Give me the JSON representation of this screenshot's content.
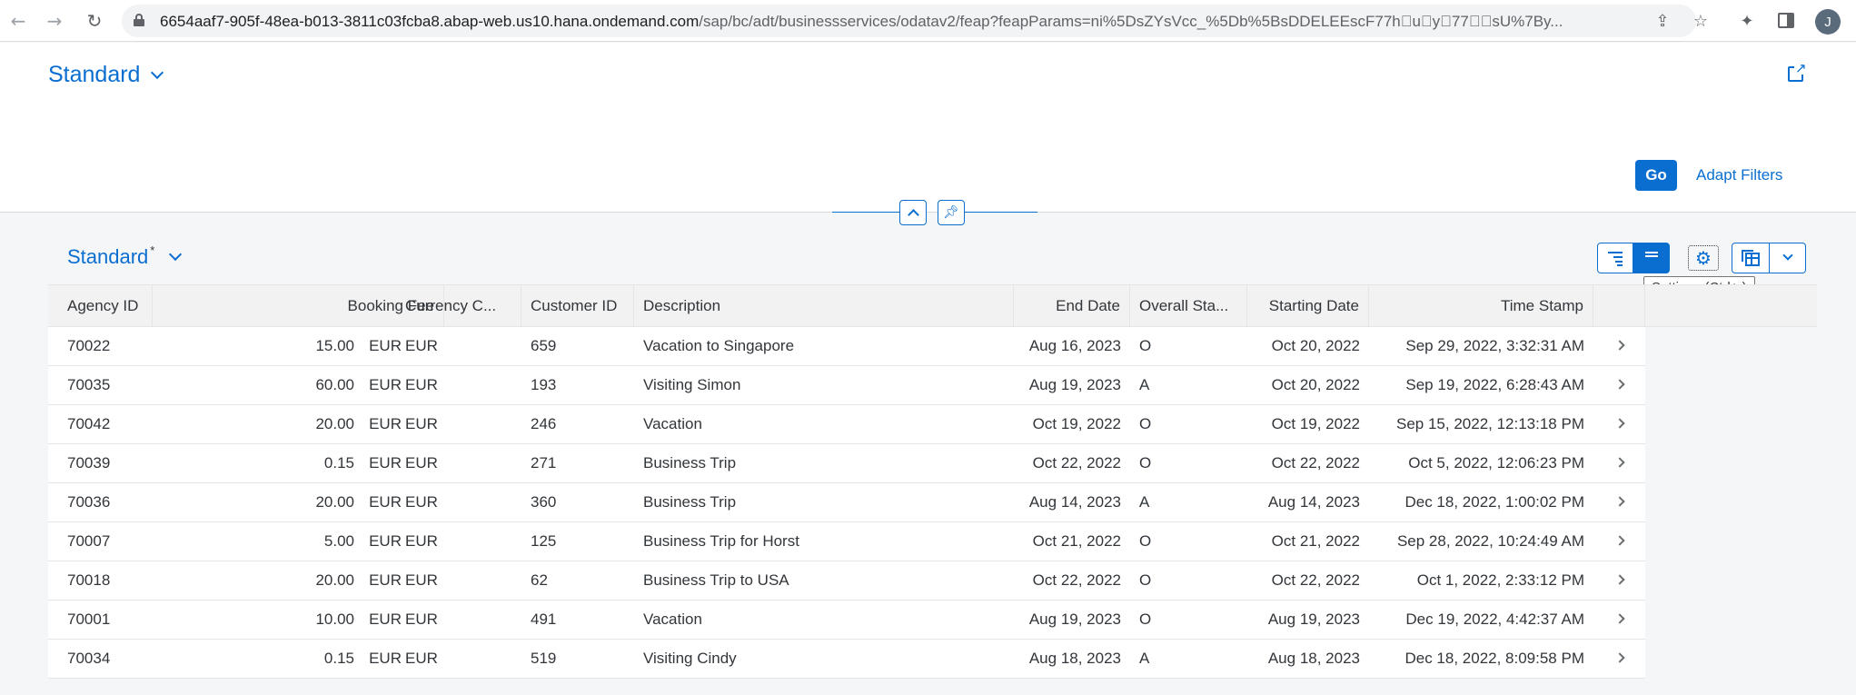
{
  "browser": {
    "url_domain": "6654aaf7-905f-48ea-b013-3811c03fcba8.abap-web.us10.hana.ondemand.com",
    "url_path": "/sap/bc/adt/businessservices/odatav2/feap?feapParams=ni%5DsZYsVcc_%5Db%5BsDDELEEscF77h\u0000u\u0000y\u000077\u0000\u0000sU%7By...",
    "avatar_initial": "J",
    "icons": [
      "back-arrow-icon",
      "forward-arrow-icon",
      "reload-icon",
      "lock-icon",
      "share-icon",
      "star-icon",
      "extensions-icon",
      "side-panel-icon"
    ]
  },
  "header": {
    "variant_label": "Standard",
    "go_label": "Go",
    "adapt_filters_label": "Adapt Filters"
  },
  "table": {
    "variant_label": "Standard",
    "variant_modified_marker": "*",
    "tooltip": "Settings (Ctrl+,)",
    "accent_color": "#0a6ed1",
    "columns": [
      "Agency ID",
      "Booking Fee",
      "Currency C...",
      "Customer ID",
      "Description",
      "End Date",
      "Overall Sta...",
      "Starting Date",
      "Time Stamp"
    ],
    "rows": [
      {
        "agency": "70022",
        "fee": "15.00",
        "fee_cur": "EUR",
        "currency": "EUR",
        "customer": "659",
        "description": "Vacation to Singapore",
        "end": "Aug 16, 2023",
        "status": "O",
        "start": "Oct 20, 2022",
        "timestamp": "Sep 29, 2022, 3:32:31 AM"
      },
      {
        "agency": "70035",
        "fee": "60.00",
        "fee_cur": "EUR",
        "currency": "EUR",
        "customer": "193",
        "description": "Visiting Simon",
        "end": "Aug 19, 2023",
        "status": "A",
        "start": "Oct 20, 2022",
        "timestamp": "Sep 19, 2022, 6:28:43 AM"
      },
      {
        "agency": "70042",
        "fee": "20.00",
        "fee_cur": "EUR",
        "currency": "EUR",
        "customer": "246",
        "description": "Vacation",
        "end": "Oct 19, 2022",
        "status": "O",
        "start": "Oct 19, 2022",
        "timestamp": "Sep 15, 2022, 12:13:18 PM"
      },
      {
        "agency": "70039",
        "fee": "0.15",
        "fee_cur": "EUR",
        "currency": "EUR",
        "customer": "271",
        "description": "Business Trip",
        "end": "Oct 22, 2022",
        "status": "O",
        "start": "Oct 22, 2022",
        "timestamp": "Oct 5, 2022, 12:06:23 PM"
      },
      {
        "agency": "70036",
        "fee": "20.00",
        "fee_cur": "EUR",
        "currency": "EUR",
        "customer": "360",
        "description": "Business Trip",
        "end": "Aug 14, 2023",
        "status": "A",
        "start": "Aug 14, 2023",
        "timestamp": "Dec 18, 2022, 1:00:02 PM"
      },
      {
        "agency": "70007",
        "fee": "5.00",
        "fee_cur": "EUR",
        "currency": "EUR",
        "customer": "125",
        "description": "Business Trip for Horst",
        "end": "Oct 21, 2022",
        "status": "O",
        "start": "Oct 21, 2022",
        "timestamp": "Sep 28, 2022, 10:24:49 AM"
      },
      {
        "agency": "70018",
        "fee": "20.00",
        "fee_cur": "EUR",
        "currency": "EUR",
        "customer": "62",
        "description": "Business Trip to USA",
        "end": "Oct 22, 2022",
        "status": "O",
        "start": "Oct 22, 2022",
        "timestamp": "Oct 1, 2022, 2:33:12 PM"
      },
      {
        "agency": "70001",
        "fee": "10.00",
        "fee_cur": "EUR",
        "currency": "EUR",
        "customer": "491",
        "description": "Vacation",
        "end": "Aug 19, 2023",
        "status": "O",
        "start": "Aug 19, 2023",
        "timestamp": "Dec 19, 2022, 4:42:37 AM"
      },
      {
        "agency": "70034",
        "fee": "0.15",
        "fee_cur": "EUR",
        "currency": "EUR",
        "customer": "519",
        "description": "Visiting Cindy",
        "end": "Aug 18, 2023",
        "status": "A",
        "start": "Aug 18, 2023",
        "timestamp": "Dec 18, 2022, 8:09:58 PM"
      }
    ]
  }
}
